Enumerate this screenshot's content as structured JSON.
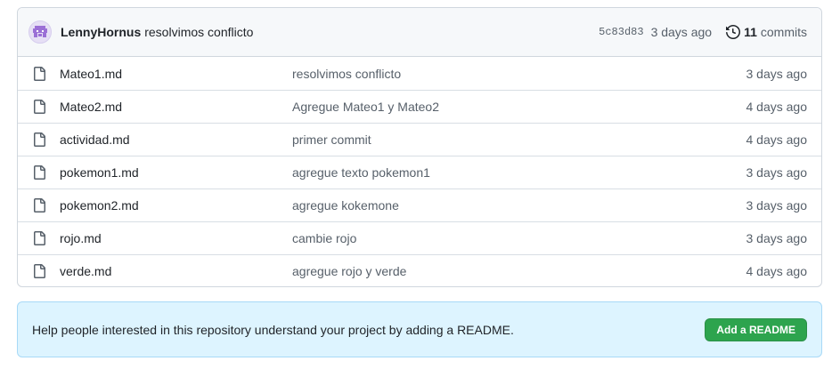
{
  "latest_commit": {
    "author": "LennyHornus",
    "message": "resolvimos conflicto",
    "sha": "5c83d83",
    "age": "3 days ago",
    "commit_count": "11",
    "commit_word": "commits",
    "avatar_icon": "identicon-avatar",
    "history_icon": "history-icon"
  },
  "files": [
    {
      "name": "Mateo1.md",
      "commit_message": "resolvimos conflicto",
      "age": "3 days ago",
      "icon": "file-icon"
    },
    {
      "name": "Mateo2.md",
      "commit_message": "Agregue Mateo1 y Mateo2",
      "age": "4 days ago",
      "icon": "file-icon"
    },
    {
      "name": "actividad.md",
      "commit_message": "primer commit",
      "age": "4 days ago",
      "icon": "file-icon"
    },
    {
      "name": "pokemon1.md",
      "commit_message": "agregue texto pokemon1",
      "age": "3 days ago",
      "icon": "file-icon"
    },
    {
      "name": "pokemon2.md",
      "commit_message": "agregue kokemone",
      "age": "3 days ago",
      "icon": "file-icon"
    },
    {
      "name": "rojo.md",
      "commit_message": "cambie rojo",
      "age": "3 days ago",
      "icon": "file-icon"
    },
    {
      "name": "verde.md",
      "commit_message": "agregue rojo y verde",
      "age": "4 days ago",
      "icon": "file-icon"
    }
  ],
  "readme_prompt": {
    "text": "Help people interested in this repository understand your project by adding a README.",
    "button_label": "Add a README"
  },
  "colors": {
    "button_green": "#2da44e",
    "banner_blue": "#ddf4ff",
    "avatar_purple": "#9b6fd6"
  }
}
